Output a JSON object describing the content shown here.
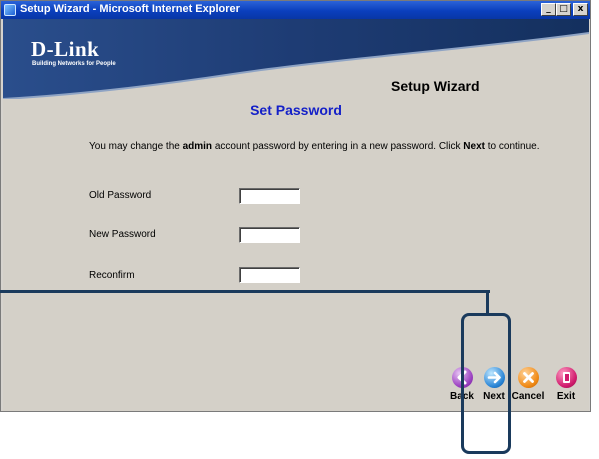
{
  "window": {
    "title": "Setup Wizard - Microsoft Internet Explorer",
    "controls": [
      "_",
      "□",
      "x"
    ]
  },
  "header": {
    "brand": "D-Link",
    "tagline": "Building Networks for People",
    "wizard_title": "Setup Wizard"
  },
  "page": {
    "section_title": "Set Password",
    "intro": {
      "part1": "You may change the ",
      "bold1": "admin",
      "part2": " account password by entering in a new password. Click ",
      "bold2": "Next",
      "part3": " to continue."
    }
  },
  "form": {
    "fields": [
      {
        "label": "Old Password",
        "value": ""
      },
      {
        "label": "New Password",
        "value": ""
      },
      {
        "label": "Reconfirm",
        "value": ""
      }
    ]
  },
  "nav": {
    "back_label": "Back",
    "next_label": "Next",
    "cancel_label": "Cancel",
    "exit_label": "Exit"
  },
  "icons": {
    "back": "back-arrow-icon",
    "next": "next-arrow-icon",
    "cancel": "cancel-x-icon",
    "exit": "exit-door-icon"
  },
  "colors": {
    "titlebar": "#0a3fbd",
    "header_band": "#1f3f78",
    "section_title": "#1420c8",
    "content_bg": "#d4d0c8",
    "callout": "#1a3a5c"
  }
}
